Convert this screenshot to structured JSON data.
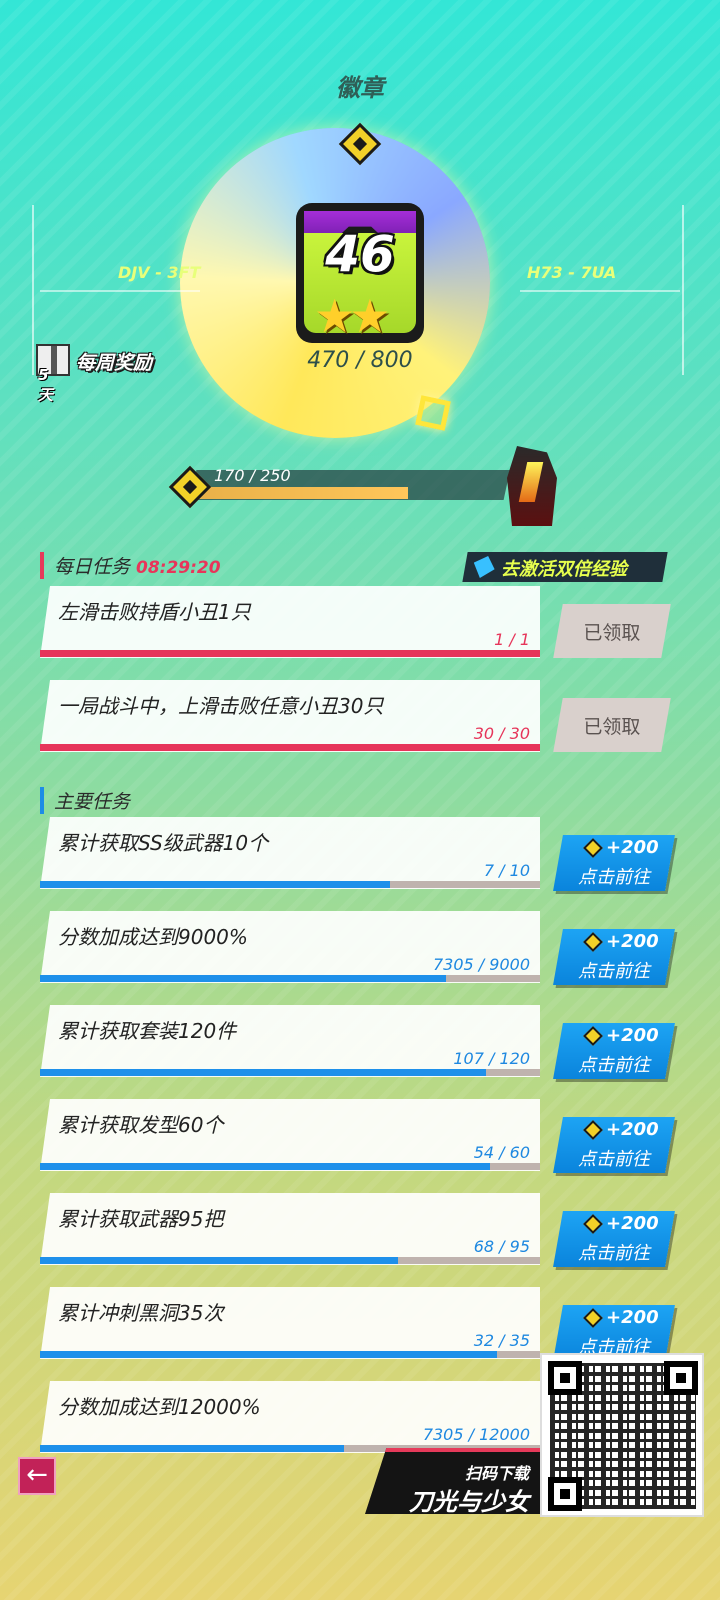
{
  "header": {
    "title": "徽章"
  },
  "badge": {
    "level": "46",
    "stars": "★★",
    "exp_text": "470 / 800",
    "code_left": "DJV - 3FT",
    "code_right": "H73 - 7UA"
  },
  "weekly": {
    "days": "5天",
    "label": "每周奖励"
  },
  "xp_bar": {
    "text": "170 / 250",
    "progress": 0.68
  },
  "daily": {
    "heading": "每日任务",
    "timer": "08:29:20",
    "double_exp_label": "去激活双倍经验",
    "tasks": [
      {
        "title": "左滑击败持盾小丑1只",
        "progress_text": "1 / 1",
        "progress": 1.0,
        "button": "已领取"
      },
      {
        "title": "一局战斗中，上滑击败任意小丑30只",
        "progress_text": "30 / 30",
        "progress": 1.0,
        "button": "已领取"
      }
    ]
  },
  "main": {
    "heading": "主要任务",
    "tasks": [
      {
        "title": "累计获取SS级武器10个",
        "progress_text": "7 / 10",
        "progress": 0.7,
        "reward": "+200",
        "button": "点击前往"
      },
      {
        "title": "分数加成达到9000%",
        "progress_text": "7305 / 9000",
        "progress": 0.8117,
        "reward": "+200",
        "button": "点击前往"
      },
      {
        "title": "累计获取套装120件",
        "progress_text": "107 / 120",
        "progress": 0.8917,
        "reward": "+200",
        "button": "点击前往"
      },
      {
        "title": "累计获取发型60个",
        "progress_text": "54 / 60",
        "progress": 0.9,
        "reward": "+200",
        "button": "点击前往"
      },
      {
        "title": "累计获取武器95把",
        "progress_text": "68 / 95",
        "progress": 0.7158,
        "reward": "+200",
        "button": "点击前往"
      },
      {
        "title": "累计冲刺黑洞35次",
        "progress_text": "32 / 35",
        "progress": 0.9143,
        "reward": "+200",
        "button": "点击前往"
      },
      {
        "title": "分数加成达到12000%",
        "progress_text": "7305 / 12000",
        "progress": 0.6088
      }
    ]
  },
  "promo": {
    "scan_label": "扫码下载",
    "game_name": "刀光与少女"
  },
  "icons": {
    "back": "back-arrow-icon",
    "gem": "diamond-gem-icon",
    "gift": "gift-box-icon",
    "book": "book-icon",
    "qr": "qr-code-icon"
  },
  "colors": {
    "accent_red": "#e6355a",
    "accent_blue": "#1e90ea",
    "badge_green": "#c9f43c",
    "badge_purple": "#a52ed8",
    "double_exp_text": "#e7ff4e"
  }
}
